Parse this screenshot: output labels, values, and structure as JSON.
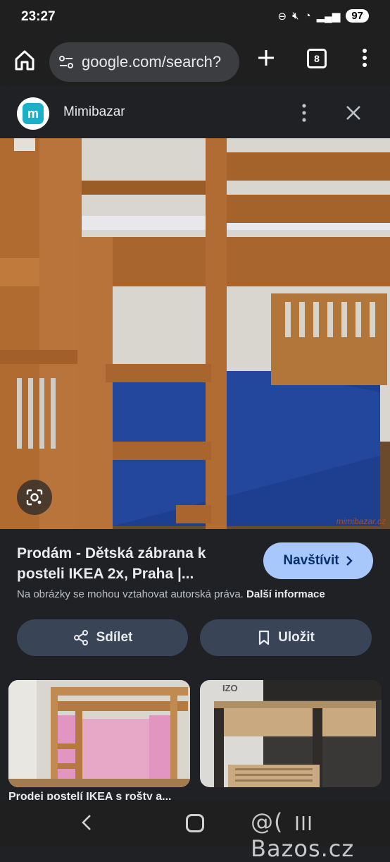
{
  "status": {
    "time": "23:27",
    "battery": "97"
  },
  "chrome": {
    "url": "google.com/search?",
    "tab_count": "8"
  },
  "sheet": {
    "site_logo": "m",
    "site_name": "Mimibazar",
    "image_watermark": "mimibazar.cz",
    "title": "Prodám - Dětská zábrana k posteli IKEA 2x, Praha |...",
    "visit_label": "Navštívit",
    "copyright_text": "Na obrázky se mohou vztahovat autorská práva.",
    "copyright_link": "Další informace",
    "share_label": "Sdílet",
    "save_label": "Uložit"
  },
  "related": [
    {
      "caption": "Prodej postelí IKEA s rošty a..."
    },
    {
      "caption": "",
      "watermark": "IZO"
    }
  ],
  "navbar": {
    "watermark": "@( Bazos.cz"
  },
  "colors": {
    "accent": "#a8c7fa",
    "button_bg": "#394457",
    "background": "#202124"
  }
}
